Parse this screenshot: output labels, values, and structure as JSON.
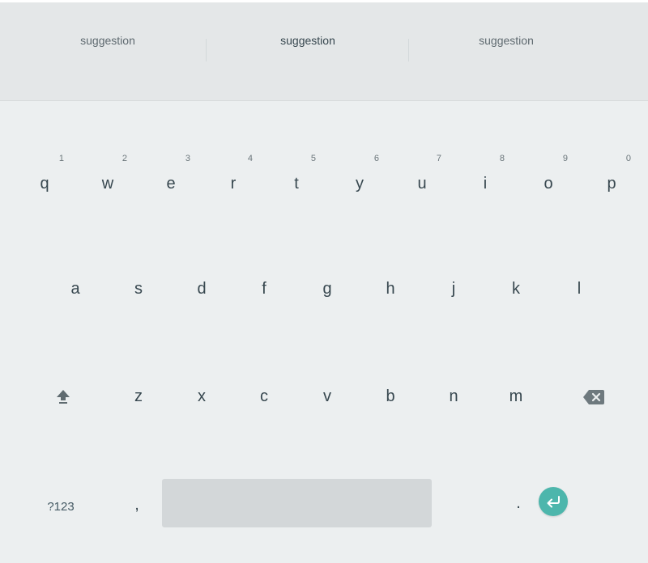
{
  "suggestions": [
    "suggestion",
    "suggestion",
    "suggestion"
  ],
  "rows": {
    "top": [
      {
        "label": "q",
        "hint": "1"
      },
      {
        "label": "w",
        "hint": "2"
      },
      {
        "label": "e",
        "hint": "3"
      },
      {
        "label": "r",
        "hint": "4"
      },
      {
        "label": "t",
        "hint": "5"
      },
      {
        "label": "y",
        "hint": "6"
      },
      {
        "label": "u",
        "hint": "7"
      },
      {
        "label": "i",
        "hint": "8"
      },
      {
        "label": "o",
        "hint": "9"
      },
      {
        "label": "p",
        "hint": "0"
      }
    ],
    "middle": [
      "a",
      "s",
      "d",
      "f",
      "g",
      "h",
      "j",
      "k",
      "l"
    ],
    "bottom": [
      "z",
      "x",
      "c",
      "v",
      "b",
      "n",
      "m"
    ]
  },
  "function_keys": {
    "symbols": "?123",
    "comma": ",",
    "period": "."
  },
  "icons": {
    "shift": "shift-icon",
    "backspace": "backspace-icon",
    "enter": "enter-icon"
  },
  "colors": {
    "background": "#eceff0",
    "suggestion_bar": "#e4e7e8",
    "key_text": "#37474f",
    "spacebar": "#d3d7d9",
    "enter_accent": "#4db6ac"
  }
}
